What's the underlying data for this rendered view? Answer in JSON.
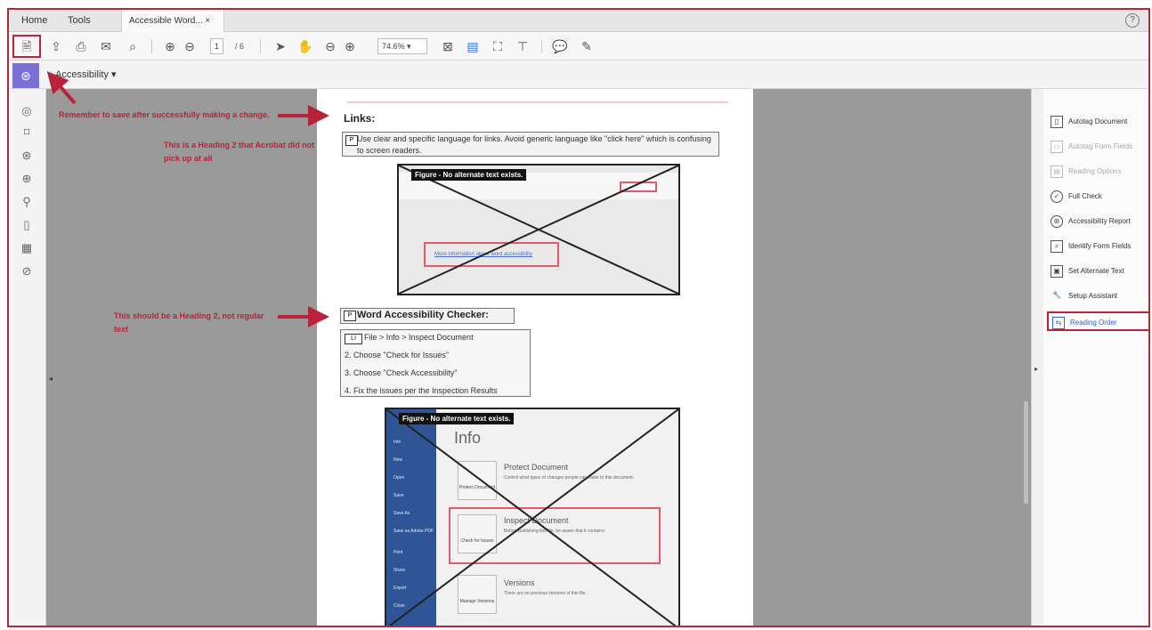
{
  "tabs": {
    "home": "Home",
    "tools": "Tools",
    "document": "Accessible Word... ×"
  },
  "help_icon": "?",
  "toolbar": {
    "page_current": "1",
    "page_total": "/ 6",
    "zoom": "74.6%  ▾"
  },
  "subbar": {
    "label": "Accessibility  ▾"
  },
  "document": {
    "links_heading": "Links:",
    "links_para": "Use clear and specific language for links. Avoid generic language like \"click here\" which is confusing to screen readers.",
    "figure_label": "Figure - No alternate text exists.",
    "figure1_link": "More information about word accessibility",
    "checker_heading": "Word Accessibility Checker:",
    "list_items": [
      "File > Info > Inspect Document",
      "2.  Choose \"Check for Issues\"",
      "3.  Choose \"Check Accessibility\"",
      "4.  Fix the issues per the Inspection Results"
    ],
    "figure2": {
      "info_title": "Info",
      "protect_head": "Protect Document",
      "protect_sub": "Control what types of changes people can make to this document.",
      "inspect_head": "Inspect Document",
      "inspect_sub": "Before publishing this file, be aware that it contains:",
      "versions_head": "Versions",
      "versions_sub": "There are no previous versions of this file.",
      "card1": "Protect Document",
      "card2": "Check for Issues",
      "card3": "Manage Versions",
      "sidebar": [
        "Info",
        "New",
        "Open",
        "Save",
        "Save As",
        "Save as Adobe PDF",
        "Print",
        "Share",
        "Export",
        "Close"
      ]
    }
  },
  "annotations": {
    "save": "Remember to save after successfully making a change.",
    "heading2_missing": "This is a Heading 2 that Acrobat did not pick up at all",
    "heading2_regular": "This should be a Heading 2, not regular text"
  },
  "tools_panel": [
    {
      "label": "Autotag Document",
      "state": "normal"
    },
    {
      "label": "Autotag Form Fields",
      "state": "disabled"
    },
    {
      "label": "Reading Options",
      "state": "disabled"
    },
    {
      "label": "Full Check",
      "state": "normal"
    },
    {
      "label": "Accessibility Report",
      "state": "normal"
    },
    {
      "label": "Identify Form Fields",
      "state": "normal"
    },
    {
      "label": "Set Alternate Text",
      "state": "normal"
    },
    {
      "label": "Setup Assistant",
      "state": "normal"
    },
    {
      "label": "Reading Order",
      "state": "active"
    }
  ],
  "colors": {
    "annotation": "#b8223a",
    "accent": "#7b6fd8",
    "highlight_border": "#c0203a"
  }
}
